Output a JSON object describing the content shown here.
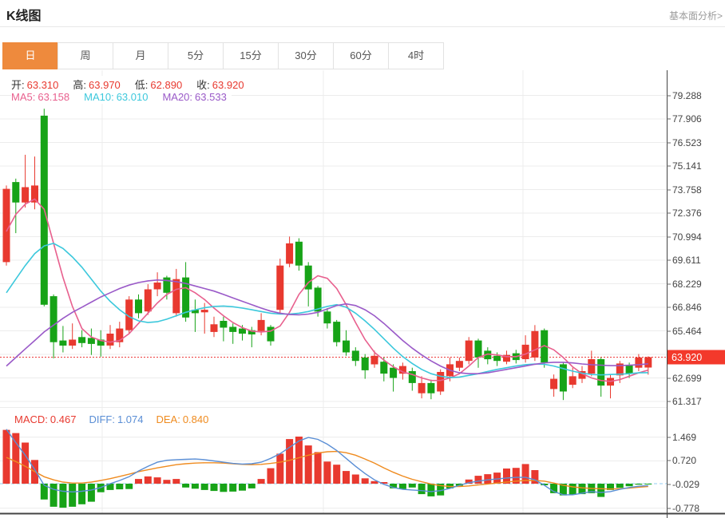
{
  "header": {
    "title": "K线图",
    "link": "基本面分析>"
  },
  "tabs": [
    {
      "label": "日",
      "active": true
    },
    {
      "label": "周",
      "active": false
    },
    {
      "label": "月",
      "active": false
    },
    {
      "label": "5分",
      "active": false
    },
    {
      "label": "15分",
      "active": false
    },
    {
      "label": "30分",
      "active": false
    },
    {
      "label": "60分",
      "active": false
    },
    {
      "label": "4时",
      "active": false
    }
  ],
  "readout": {
    "open_label": "开:",
    "open_value": "63.310",
    "high_label": "高:",
    "high_value": "63.970",
    "low_label": "低:",
    "low_value": "62.890",
    "close_label": "收:",
    "close_value": "63.920",
    "ma5_label": "MA5:",
    "ma5_value": "63.158",
    "ma10_label": "MA10:",
    "ma10_value": "63.010",
    "ma20_label": "MA20:",
    "ma20_value": "63.533"
  },
  "macd_readout": {
    "macd_label": "MACD:",
    "macd_value": "0.467",
    "diff_label": "DIFF:",
    "diff_value": "1.074",
    "dea_label": "DEA:",
    "dea_value": "0.840"
  },
  "colors": {
    "up": "#e8392f",
    "down": "#17a317",
    "ma5": "#e8608e",
    "ma10": "#3cc8dc",
    "ma20": "#9a5ac8",
    "diff": "#5a8ed5",
    "dea": "#ef8b1f",
    "grid": "#ececec",
    "axis": "#444444",
    "axis_text": "#444444",
    "price_line": "#ed3a3a",
    "badge": "#f3392b",
    "zero_line": "#a8d7f5",
    "tab_active_bg": "#ee8a3d",
    "link_text": "#9b9b9b"
  },
  "chart_data": {
    "type": "candlestick",
    "title": "K线图",
    "interval": "日",
    "legend": [
      "MA5",
      "MA10",
      "MA20",
      "MACD",
      "DIFF",
      "DEA"
    ],
    "ylim": [
      61.317,
      79.288
    ],
    "macd_ylim": [
      -0.778,
      1.469
    ],
    "grid": true,
    "axis_side": "right",
    "price_axis": [
      {
        "value": 79.288,
        "label": "79.288"
      },
      {
        "value": 77.906,
        "label": "77.906"
      },
      {
        "value": 76.523,
        "label": "76.523"
      },
      {
        "value": 75.141,
        "label": "75.141"
      },
      {
        "value": 73.758,
        "label": "73.758"
      },
      {
        "value": 72.376,
        "label": "72.376"
      },
      {
        "value": 70.994,
        "label": "70.994"
      },
      {
        "value": 69.611,
        "label": "69.611"
      },
      {
        "value": 68.229,
        "label": "68.229"
      },
      {
        "value": 66.846,
        "label": "66.846"
      },
      {
        "value": 65.464,
        "label": "65.464"
      },
      {
        "value": 64.082,
        "label": ""
      },
      {
        "value": 62.699,
        "label": "62.699"
      },
      {
        "value": 61.317,
        "label": "61.317"
      }
    ],
    "current_price": 63.92,
    "current_price_label": "63.920",
    "macd_axis": [
      {
        "value": 1.469,
        "label": "1.469"
      },
      {
        "value": 0.72,
        "label": "0.720"
      },
      {
        "value": -0.029,
        "label": "-0.029",
        "zero": true
      },
      {
        "value": -0.778,
        "label": "-0.778"
      }
    ],
    "month_gridlines_x": [
      128,
      405,
      655
    ],
    "candles": [
      [
        69.5,
        74.0,
        69.3,
        73.8
      ],
      [
        74.2,
        74.4,
        71.2,
        73.0
      ],
      [
        73.0,
        75.8,
        72.7,
        73.9
      ],
      [
        73.0,
        75.7,
        72.6,
        74.0
      ],
      [
        78.1,
        78.5,
        66.9,
        67.0
      ],
      [
        67.5,
        67.6,
        63.85,
        64.8
      ],
      [
        64.9,
        65.75,
        64.2,
        64.6
      ],
      [
        64.6,
        65.9,
        64.4,
        64.95
      ],
      [
        65.1,
        65.5,
        64.5,
        64.75
      ],
      [
        65.05,
        65.6,
        64.05,
        64.7
      ],
      [
        64.95,
        65.5,
        63.95,
        64.6
      ],
      [
        64.6,
        65.8,
        64.4,
        65.3
      ],
      [
        64.8,
        66.0,
        64.5,
        65.6
      ],
      [
        65.5,
        67.5,
        65.3,
        67.3
      ],
      [
        67.3,
        67.6,
        66.2,
        66.5
      ],
      [
        66.6,
        68.2,
        66.4,
        67.9
      ],
      [
        67.9,
        68.9,
        67.5,
        68.3
      ],
      [
        68.6,
        68.7,
        67.3,
        67.7
      ],
      [
        66.5,
        69.1,
        66.3,
        68.5
      ],
      [
        68.6,
        69.5,
        66.0,
        66.25
      ],
      [
        66.7,
        67.3,
        65.4,
        66.5
      ],
      [
        66.55,
        67.1,
        65.3,
        66.7
      ],
      [
        65.4,
        66.3,
        65.1,
        65.85
      ],
      [
        66.05,
        66.3,
        64.85,
        65.65
      ],
      [
        65.7,
        65.9,
        64.7,
        65.4
      ],
      [
        65.6,
        65.8,
        64.9,
        65.3
      ],
      [
        65.5,
        65.7,
        64.5,
        65.25
      ],
      [
        65.45,
        66.5,
        65.2,
        66.1
      ],
      [
        65.7,
        65.8,
        64.6,
        64.85
      ],
      [
        66.7,
        69.7,
        66.5,
        69.3
      ],
      [
        69.4,
        71.0,
        69.2,
        70.6
      ],
      [
        70.7,
        70.9,
        69.0,
        69.3
      ],
      [
        69.3,
        69.5,
        66.9,
        67.9
      ],
      [
        68.0,
        68.1,
        66.3,
        66.6
      ],
      [
        66.6,
        66.8,
        65.6,
        65.9
      ],
      [
        66.0,
        66.1,
        64.55,
        64.8
      ],
      [
        64.9,
        65.5,
        64.0,
        64.2
      ],
      [
        64.3,
        64.5,
        63.4,
        63.7
      ],
      [
        63.9,
        64.1,
        62.65,
        63.15
      ],
      [
        63.5,
        64.3,
        63.3,
        64.0
      ],
      [
        63.65,
        63.9,
        62.5,
        62.95
      ],
      [
        63.3,
        63.5,
        61.9,
        62.7
      ],
      [
        62.95,
        63.6,
        62.6,
        63.4
      ],
      [
        63.1,
        63.3,
        61.95,
        62.4
      ],
      [
        61.8,
        62.8,
        61.5,
        62.4
      ],
      [
        62.4,
        62.6,
        61.45,
        61.8
      ],
      [
        61.9,
        63.2,
        61.7,
        63.05
      ],
      [
        62.8,
        63.9,
        62.5,
        63.5
      ],
      [
        63.3,
        63.9,
        63.1,
        63.7
      ],
      [
        63.7,
        65.1,
        63.5,
        64.9
      ],
      [
        64.9,
        65.0,
        63.3,
        63.9
      ],
      [
        64.3,
        64.5,
        63.5,
        63.8
      ],
      [
        64.0,
        64.2,
        63.4,
        63.7
      ],
      [
        63.65,
        64.3,
        63.5,
        64.05
      ],
      [
        64.15,
        64.35,
        63.55,
        63.75
      ],
      [
        63.8,
        65.2,
        63.6,
        64.65
      ],
      [
        63.9,
        65.8,
        63.7,
        65.45
      ],
      [
        65.5,
        65.6,
        63.3,
        63.6
      ],
      [
        62.05,
        62.9,
        61.6,
        62.65
      ],
      [
        63.5,
        63.6,
        61.4,
        61.9
      ],
      [
        62.3,
        63.3,
        62.1,
        62.8
      ],
      [
        62.65,
        63.4,
        62.4,
        63.1
      ],
      [
        62.95,
        64.3,
        62.8,
        63.8
      ],
      [
        63.8,
        63.9,
        61.6,
        62.25
      ],
      [
        62.25,
        62.9,
        61.5,
        62.7
      ],
      [
        62.85,
        63.7,
        62.4,
        63.55
      ],
      [
        63.45,
        63.6,
        62.7,
        62.95
      ],
      [
        63.3,
        64.1,
        63.1,
        63.9
      ],
      [
        63.31,
        63.97,
        62.89,
        63.92
      ]
    ],
    "ma5": [
      71.3,
      72.3,
      72.9,
      73.2,
      72.6,
      70.6,
      68.6,
      66.9,
      65.6,
      65.1,
      64.9,
      64.8,
      64.9,
      65.3,
      65.9,
      66.5,
      67.1,
      67.6,
      67.9,
      68.0,
      67.7,
      67.3,
      66.8,
      66.35,
      65.95,
      65.65,
      65.45,
      65.4,
      65.45,
      65.75,
      66.55,
      67.6,
      68.3,
      68.7,
      68.55,
      67.95,
      67.0,
      65.95,
      64.95,
      64.2,
      63.75,
      63.35,
      63.05,
      62.9,
      62.7,
      62.55,
      62.55,
      62.7,
      62.95,
      63.4,
      63.9,
      64.1,
      64.05,
      63.95,
      63.95,
      64.1,
      64.35,
      64.6,
      64.35,
      63.9,
      63.35,
      62.95,
      62.7,
      62.55,
      62.5,
      62.6,
      62.8,
      63.0,
      63.16
    ],
    "ma10": [
      67.7,
      68.5,
      69.3,
      70.0,
      70.45,
      70.6,
      70.3,
      69.8,
      69.2,
      68.5,
      67.8,
      67.2,
      66.7,
      66.3,
      66.05,
      65.95,
      66.0,
      66.15,
      66.35,
      66.55,
      66.7,
      66.82,
      66.9,
      66.92,
      66.88,
      66.8,
      66.7,
      66.6,
      66.5,
      66.45,
      66.45,
      66.5,
      66.6,
      66.75,
      66.9,
      67.0,
      66.85,
      66.5,
      66.05,
      65.55,
      65.0,
      64.45,
      63.95,
      63.55,
      63.2,
      62.95,
      62.8,
      62.72,
      62.75,
      62.85,
      62.95,
      63.08,
      63.2,
      63.3,
      63.4,
      63.48,
      63.52,
      63.5,
      63.4,
      63.25,
      63.1,
      62.98,
      62.9,
      62.88,
      62.9,
      62.92,
      62.95,
      63.0,
      63.01
    ],
    "ma20": [
      63.4,
      63.9,
      64.4,
      64.9,
      65.4,
      65.8,
      66.2,
      66.55,
      66.85,
      67.15,
      67.45,
      67.7,
      67.95,
      68.15,
      68.3,
      68.4,
      68.45,
      68.42,
      68.35,
      68.25,
      68.1,
      67.95,
      67.8,
      67.6,
      67.4,
      67.2,
      67.0,
      66.8,
      66.62,
      66.5,
      66.42,
      66.4,
      66.45,
      66.55,
      66.75,
      66.95,
      67.05,
      66.95,
      66.7,
      66.35,
      65.9,
      65.4,
      64.9,
      64.45,
      64.05,
      63.7,
      63.4,
      63.15,
      63.0,
      62.95,
      62.95,
      63.0,
      63.1,
      63.2,
      63.3,
      63.4,
      63.5,
      63.58,
      63.62,
      63.62,
      63.58,
      63.52,
      63.48,
      63.45,
      63.42,
      63.42,
      63.45,
      63.48,
      63.53
    ],
    "macd_hist": [
      1.7,
      1.6,
      1.3,
      0.75,
      -0.5,
      -0.73,
      -0.76,
      -0.73,
      -0.65,
      -0.57,
      -0.27,
      -0.2,
      -0.18,
      -0.17,
      0.15,
      0.23,
      0.2,
      0.12,
      0.15,
      -0.12,
      -0.16,
      -0.2,
      -0.23,
      -0.26,
      -0.25,
      -0.22,
      -0.15,
      0.15,
      0.49,
      0.95,
      1.41,
      1.49,
      1.21,
      1.0,
      0.7,
      0.6,
      0.4,
      0.29,
      0.17,
      0.08,
      0.05,
      -0.15,
      -0.17,
      -0.12,
      -0.33,
      -0.4,
      -0.37,
      -0.15,
      -0.07,
      0.13,
      0.25,
      0.3,
      0.35,
      0.48,
      0.5,
      0.62,
      0.43,
      -0.05,
      -0.3,
      -0.37,
      -0.35,
      -0.33,
      -0.3,
      -0.42,
      -0.2,
      -0.13,
      -0.08,
      -0.03,
      -0.02
    ],
    "diff": [
      1.72,
      1.3,
      0.9,
      0.45,
      -0.05,
      -0.18,
      -0.24,
      -0.26,
      -0.24,
      -0.2,
      -0.12,
      0.0,
      0.1,
      0.22,
      0.4,
      0.55,
      0.68,
      0.74,
      0.76,
      0.77,
      0.78,
      0.76,
      0.72,
      0.68,
      0.64,
      0.62,
      0.63,
      0.68,
      0.8,
      0.95,
      1.15,
      1.35,
      1.46,
      1.4,
      1.25,
      1.05,
      0.8,
      0.55,
      0.32,
      0.12,
      -0.02,
      -0.12,
      -0.18,
      -0.2,
      -0.22,
      -0.25,
      -0.22,
      -0.15,
      -0.05,
      0.03,
      0.08,
      0.12,
      0.15,
      0.18,
      0.2,
      0.2,
      0.12,
      -0.05,
      -0.25,
      -0.35,
      -0.35,
      -0.3,
      -0.25,
      -0.28,
      -0.25,
      -0.18,
      -0.12,
      -0.08,
      -0.06
    ],
    "dea": [
      0.83,
      0.7,
      0.55,
      0.38,
      0.22,
      0.12,
      0.05,
      0.02,
      0.02,
      0.05,
      0.1,
      0.16,
      0.23,
      0.3,
      0.38,
      0.44,
      0.5,
      0.55,
      0.6,
      0.63,
      0.65,
      0.66,
      0.66,
      0.65,
      0.63,
      0.61,
      0.6,
      0.61,
      0.64,
      0.68,
      0.74,
      0.82,
      0.9,
      0.97,
      1.01,
      1.02,
      0.98,
      0.9,
      0.78,
      0.65,
      0.5,
      0.36,
      0.24,
      0.14,
      0.06,
      -0.01,
      -0.06,
      -0.09,
      -0.09,
      -0.07,
      -0.04,
      -0.01,
      0.02,
      0.05,
      0.08,
      0.1,
      0.1,
      0.08,
      0.02,
      -0.05,
      -0.1,
      -0.13,
      -0.15,
      -0.16,
      -0.17,
      -0.16,
      -0.14,
      -0.11,
      -0.09
    ]
  }
}
